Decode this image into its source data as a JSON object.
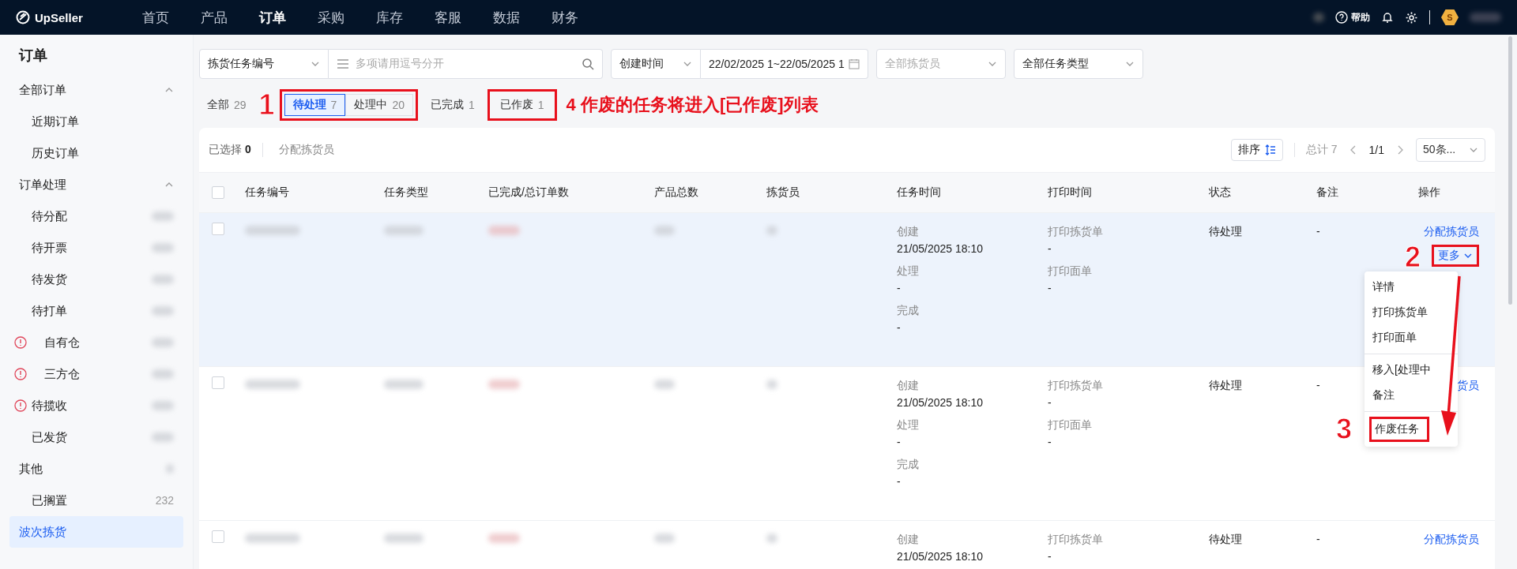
{
  "topbar": {
    "logo": "UpSeller",
    "nav": [
      {
        "label": "首页",
        "selected": false
      },
      {
        "label": "产品",
        "selected": false
      },
      {
        "label": "订单",
        "selected": true
      },
      {
        "label": "采购",
        "selected": false
      },
      {
        "label": "库存",
        "selected": false
      },
      {
        "label": "客服",
        "selected": false
      },
      {
        "label": "数据",
        "selected": false
      },
      {
        "label": "财务",
        "selected": false
      }
    ],
    "help": "帮助",
    "badge": "S"
  },
  "sidebar": {
    "title": "订单",
    "groups": [
      {
        "label": "全部订单",
        "expanded": true,
        "children": [
          {
            "label": "近期订单",
            "selected": false
          },
          {
            "label": "历史订单",
            "selected": false
          }
        ]
      },
      {
        "label": "订单处理",
        "expanded": true,
        "children": [
          {
            "label": "待分配",
            "count_hidden": true,
            "selected": false
          },
          {
            "label": "待开票",
            "count_hidden": true,
            "selected": false
          },
          {
            "label": "待发货",
            "count_hidden": true,
            "selected": false
          },
          {
            "label": "待打单",
            "count_hidden": true,
            "selected": false,
            "children": [
              {
                "label": "自有仓",
                "alert": true,
                "count_hidden": true,
                "selected": false
              },
              {
                "label": "三方仓",
                "alert": true,
                "count_hidden": true,
                "selected": false
              }
            ]
          },
          {
            "label": "待揽收",
            "alert": true,
            "count_hidden": true,
            "selected": false
          },
          {
            "label": "已发货",
            "count_hidden": true,
            "selected": false
          }
        ]
      },
      {
        "label": "其他",
        "expanded": false,
        "count_hidden": true,
        "children": [
          {
            "label": "已搁置",
            "count": "232",
            "selected": false
          }
        ]
      },
      {
        "label": "波次拣货",
        "selected": true
      }
    ]
  },
  "filters": {
    "search_type": "拣货任务编号",
    "search_placeholder": "多项请用逗号分开",
    "time_type": "创建时间",
    "date_range": "22/02/2025 1~22/05/2025 1",
    "picker_placeholder": "全部拣货员",
    "task_type": "全部任务类型"
  },
  "tabs": [
    {
      "kind": "single",
      "label": "全部",
      "count": "29",
      "selected": false
    },
    {
      "kind": "group",
      "highlighted": true,
      "callout": "1",
      "items": [
        {
          "label": "待处理",
          "count": "7",
          "selected": true
        },
        {
          "label": "处理中",
          "count": "20",
          "selected": false
        }
      ]
    },
    {
      "kind": "single",
      "label": "已完成",
      "count": "1",
      "selected": false
    },
    {
      "kind": "single",
      "label": "已作废",
      "count": "1",
      "selected": false,
      "highlighted": true,
      "note": "4 作废的任务将进入[已作废]列表"
    }
  ],
  "toolbar": {
    "selected_label": "已选择",
    "selected_count": "0",
    "assign": "分配拣货员",
    "sort": "排序",
    "total": "总计 7",
    "page": "1/1",
    "page_size": "50条..."
  },
  "table": {
    "select_all_checked": false,
    "columns": [
      "任务编号",
      "任务类型",
      "已完成/总订单数",
      "产品总数",
      "拣货员",
      "任务时间",
      "打印时间",
      "状态",
      "备注",
      "操作"
    ],
    "rows": [
      {
        "checked": false,
        "hidden_cells": true,
        "highlighted": true,
        "times": [
          {
            "label": "创建",
            "value": "21/05/2025 18:10"
          },
          {
            "label": "处理",
            "value": "-"
          },
          {
            "label": "完成",
            "value": "-"
          }
        ],
        "prints": [
          {
            "label": "打印拣货单",
            "value": "-"
          },
          {
            "label": "打印面单",
            "value": "-"
          }
        ],
        "status": "待处理",
        "note": "-",
        "action": "分配拣货员",
        "more": {
          "label": "更多",
          "highlighted": true,
          "callout": "2",
          "open": true
        }
      },
      {
        "checked": false,
        "hidden_cells": true,
        "highlighted": false,
        "times": [
          {
            "label": "创建",
            "value": "21/05/2025 18:10"
          },
          {
            "label": "处理",
            "value": "-"
          },
          {
            "label": "完成",
            "value": "-"
          }
        ],
        "prints": [
          {
            "label": "打印拣货单",
            "value": "-"
          },
          {
            "label": "打印面单",
            "value": "-"
          }
        ],
        "status": "待处理",
        "note": "-",
        "action": "货员"
      },
      {
        "checked": false,
        "hidden_cells": true,
        "highlighted": false,
        "times": [
          {
            "label": "创建",
            "value": "21/05/2025 18:10"
          }
        ],
        "prints": [
          {
            "label": "打印拣货单",
            "value": "-"
          }
        ],
        "status": "待处理",
        "note": "-",
        "action": "分配拣货员"
      }
    ]
  },
  "menu": {
    "items": [
      {
        "label": "详情",
        "divider_before": false,
        "highlighted": false
      },
      {
        "label": "打印拣货单",
        "divider_before": false,
        "highlighted": false
      },
      {
        "label": "打印面单",
        "divider_before": false,
        "highlighted": false
      },
      {
        "label": "移入[处理中",
        "divider_before": true,
        "highlighted": false
      },
      {
        "label": "备注",
        "divider_before": false,
        "highlighted": false
      },
      {
        "label": "作废任务",
        "divider_before": true,
        "highlighted": true,
        "callout": "3"
      }
    ]
  }
}
